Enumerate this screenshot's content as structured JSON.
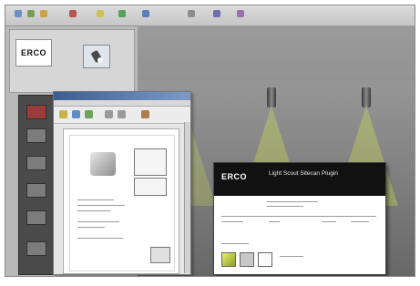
{
  "erco_panel": {
    "logo_text": "ERCO"
  },
  "plugin_window": {
    "logo_text": "ERCO",
    "title": "Light Scout Sitecan Plugin"
  },
  "icons": {
    "toolbar": [
      "pointer-icon",
      "rotate-icon",
      "zoom-icon",
      "pan-icon",
      "light-icon",
      "render-icon",
      "camera-icon",
      "settings-icon"
    ],
    "sidebar": [
      "tool-icon-1",
      "tool-icon-2",
      "tool-icon-3",
      "tool-icon-4",
      "tool-icon-5",
      "tool-icon-6"
    ]
  },
  "colors": {
    "light_cone": "#d2e650",
    "doc_titlebar": "#3c5d93",
    "plugin_header": "#111111"
  }
}
